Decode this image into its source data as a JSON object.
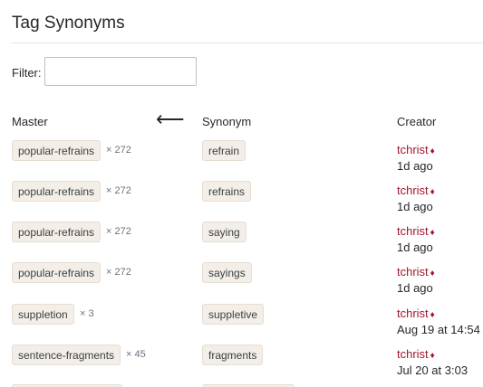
{
  "page": {
    "title": "Tag Synonyms"
  },
  "filter": {
    "label": "Filter:",
    "value": "",
    "placeholder": ""
  },
  "columns": {
    "master": "Master",
    "arrow": "⟵",
    "synonym": "Synonym",
    "creator": "Creator"
  },
  "colors": {
    "tag_bg": "#f4eee8",
    "creator": "#a1182a",
    "rule": "#e4e6e8"
  },
  "rows": [
    {
      "master": "popular-refrains",
      "count": "× 272",
      "synonym": "refrain",
      "creator": "tchrist",
      "diamond": "♦",
      "when": "1d ago"
    },
    {
      "master": "popular-refrains",
      "count": "× 272",
      "synonym": "refrains",
      "creator": "tchrist",
      "diamond": "♦",
      "when": "1d ago"
    },
    {
      "master": "popular-refrains",
      "count": "× 272",
      "synonym": "saying",
      "creator": "tchrist",
      "diamond": "♦",
      "when": "1d ago"
    },
    {
      "master": "popular-refrains",
      "count": "× 272",
      "synonym": "sayings",
      "creator": "tchrist",
      "diamond": "♦",
      "when": "1d ago"
    },
    {
      "master": "suppletion",
      "count": "× 3",
      "synonym": "suppletive",
      "creator": "tchrist",
      "diamond": "♦",
      "when": "Aug 19 at 14:54"
    },
    {
      "master": "sentence-fragments",
      "count": "× 45",
      "synonym": "fragments",
      "creator": "tchrist",
      "diamond": "♦",
      "when": "Jul 20 at 3:03"
    }
  ]
}
